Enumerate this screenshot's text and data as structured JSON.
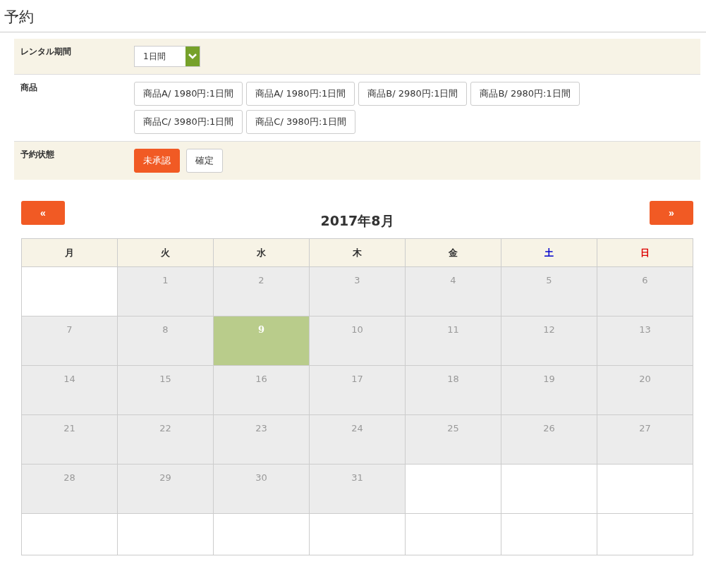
{
  "page_title": "予約",
  "form": {
    "rows": [
      {
        "kind": "select",
        "label": "レンタル期間",
        "value": "1日間"
      },
      {
        "kind": "products",
        "label": "商品",
        "items": [
          "商品A/ 1980円:1日間",
          "商品A/ 1980円:1日間",
          "商品B/ 2980円:1日間",
          "商品B/ 2980円:1日間",
          "商品C/ 3980円:1日間",
          "商品C/ 3980円:1日間"
        ]
      },
      {
        "kind": "status",
        "label": "予約状態",
        "options": [
          {
            "label": "未承認",
            "selected": true
          },
          {
            "label": "確定",
            "selected": false
          }
        ]
      }
    ]
  },
  "calendar": {
    "prev": "«",
    "next": "»",
    "title": "2017年8月",
    "weekdays": [
      {
        "label": "月",
        "color": "#333333"
      },
      {
        "label": "火",
        "color": "#333333"
      },
      {
        "label": "水",
        "color": "#333333"
      },
      {
        "label": "木",
        "color": "#333333"
      },
      {
        "label": "金",
        "color": "#333333"
      },
      {
        "label": "土",
        "color": "#0000cc"
      },
      {
        "label": "日",
        "color": "#dd0000"
      }
    ],
    "weeks": [
      [
        {
          "kind": "blank"
        },
        {
          "kind": "day",
          "day": "1",
          "selected": false
        },
        {
          "kind": "day",
          "day": "2",
          "selected": false
        },
        {
          "kind": "day",
          "day": "3",
          "selected": false
        },
        {
          "kind": "day",
          "day": "4",
          "selected": false
        },
        {
          "kind": "day",
          "day": "5",
          "selected": false
        },
        {
          "kind": "day",
          "day": "6",
          "selected": false
        }
      ],
      [
        {
          "kind": "day",
          "day": "7",
          "selected": false
        },
        {
          "kind": "day",
          "day": "8",
          "selected": false
        },
        {
          "kind": "day",
          "day": "9",
          "selected": true
        },
        {
          "kind": "day",
          "day": "10",
          "selected": false
        },
        {
          "kind": "day",
          "day": "11",
          "selected": false
        },
        {
          "kind": "day",
          "day": "12",
          "selected": false
        },
        {
          "kind": "day",
          "day": "13",
          "selected": false
        }
      ],
      [
        {
          "kind": "day",
          "day": "14",
          "selected": false
        },
        {
          "kind": "day",
          "day": "15",
          "selected": false
        },
        {
          "kind": "day",
          "day": "16",
          "selected": false
        },
        {
          "kind": "day",
          "day": "17",
          "selected": false
        },
        {
          "kind": "day",
          "day": "18",
          "selected": false
        },
        {
          "kind": "day",
          "day": "19",
          "selected": false
        },
        {
          "kind": "day",
          "day": "20",
          "selected": false
        }
      ],
      [
        {
          "kind": "day",
          "day": "21",
          "selected": false
        },
        {
          "kind": "day",
          "day": "22",
          "selected": false
        },
        {
          "kind": "day",
          "day": "23",
          "selected": false
        },
        {
          "kind": "day",
          "day": "24",
          "selected": false
        },
        {
          "kind": "day",
          "day": "25",
          "selected": false
        },
        {
          "kind": "day",
          "day": "26",
          "selected": false
        },
        {
          "kind": "day",
          "day": "27",
          "selected": false
        }
      ],
      [
        {
          "kind": "day",
          "day": "28",
          "selected": false
        },
        {
          "kind": "day",
          "day": "29",
          "selected": false
        },
        {
          "kind": "day",
          "day": "30",
          "selected": false
        },
        {
          "kind": "day",
          "day": "31",
          "selected": false
        },
        {
          "kind": "blank"
        },
        {
          "kind": "blank"
        },
        {
          "kind": "blank"
        }
      ],
      [
        {
          "kind": "blank"
        },
        {
          "kind": "blank"
        },
        {
          "kind": "blank"
        },
        {
          "kind": "blank"
        },
        {
          "kind": "blank"
        },
        {
          "kind": "blank"
        },
        {
          "kind": "blank"
        }
      ]
    ]
  }
}
